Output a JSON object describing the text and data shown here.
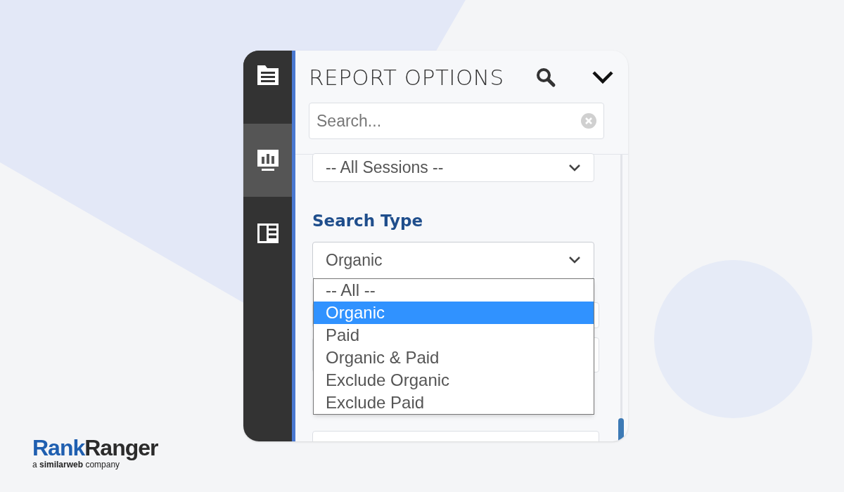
{
  "sidebar": {
    "items": [
      {
        "kind": "document",
        "selected": false
      },
      {
        "kind": "chart",
        "selected": true
      },
      {
        "kind": "layout",
        "selected": false
      }
    ]
  },
  "panel": {
    "title": "REPORT OPTIONS",
    "search": {
      "placeholder": "Search..."
    }
  },
  "sessions_select": {
    "value": "-- All Sessions --"
  },
  "search_type": {
    "label": "Search Type",
    "value": "Organic",
    "expanded": true,
    "options": [
      {
        "label": "-- All --",
        "selected": false
      },
      {
        "label": "Organic",
        "selected": true
      },
      {
        "label": "Paid",
        "selected": false
      },
      {
        "label": "Organic & Paid",
        "selected": false
      },
      {
        "label": "Exclude Organic",
        "selected": false
      },
      {
        "label": "Exclude Paid",
        "selected": false
      }
    ]
  },
  "logo": {
    "brand_first": "Rank",
    "brand_second": "Ranger",
    "tagline": "a **similarweb** company"
  }
}
